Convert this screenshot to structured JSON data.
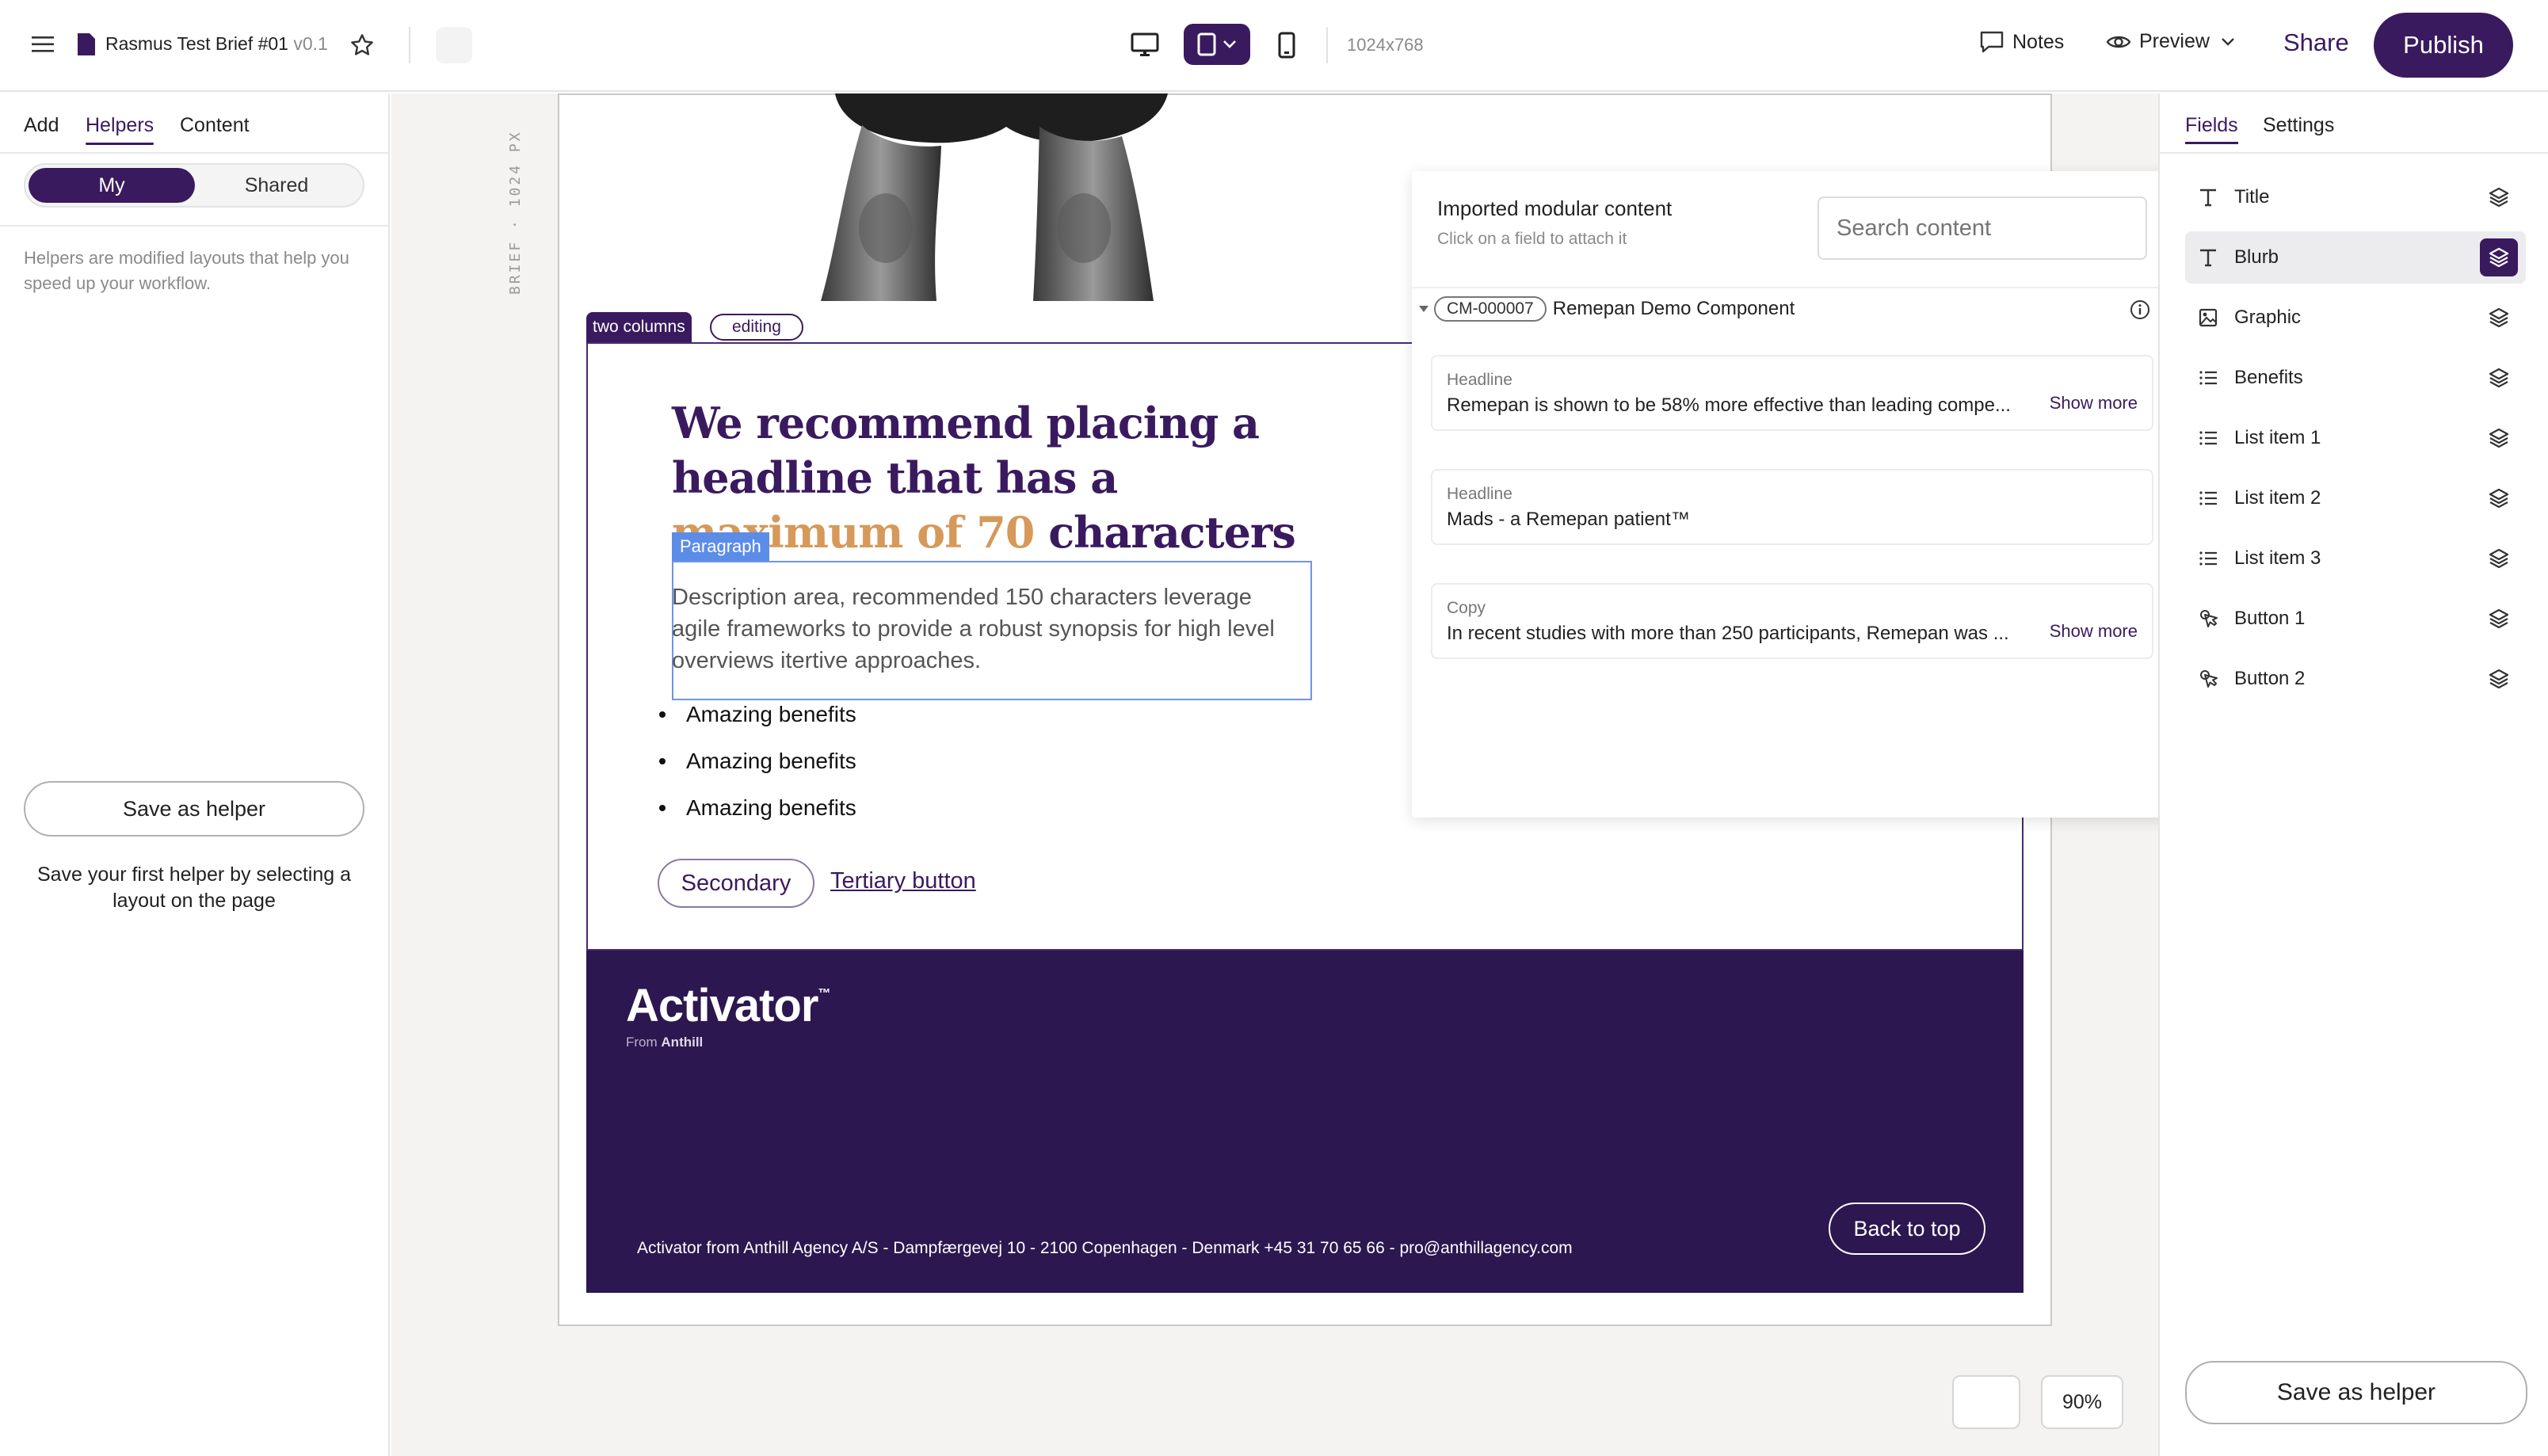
{
  "topbar": {
    "doc_title": "Rasmus Test Brief #01",
    "version": "v0.1",
    "resolution": "1024x768",
    "notes_label": "Notes",
    "preview_label": "Preview",
    "share_label": "Share",
    "publish_label": "Publish"
  },
  "left": {
    "tabs": [
      "Add",
      "Helpers",
      "Content"
    ],
    "active_tab": "Helpers",
    "segments": [
      "My",
      "Shared"
    ],
    "helper_desc": "Helpers are modified layouts that help you speed up your workflow.",
    "save_helper_label": "Save as helper",
    "save_hint": "Save your first helper by selecting a layout on the page"
  },
  "canvas": {
    "ruler_label": "BRIEF · 1024 PX",
    "layout_tag": "two columns",
    "layout_state": "editing",
    "headline_part1": "We recommend placing a headline that has a",
    "headline_highlight": "maximum of 70",
    "headline_part2": "characters",
    "paragraph_tag": "Paragraph",
    "paragraph": "Description area, recommended 150 characters leverage agile frameworks to provide a robust synopsis for high level overviews itertive approaches.",
    "benefits": [
      "Amazing benefits",
      "Amazing benefits",
      "Amazing benefits"
    ],
    "secondary_label": "Secondary",
    "tertiary_label": "Tertiary button",
    "brand": "Activator",
    "brand_tm": "™",
    "brand_from": "From",
    "brand_company": "Anthill",
    "footer_text": "Activator from Anthill Agency A/S - Dampfærgevej 10 - 2100 Copenhagen - Denmark +45 31 70 65 66 - pro@anthillagency.com",
    "back_to_top": "Back to top",
    "zoom": "90%"
  },
  "imported": {
    "title": "Imported modular content",
    "subtitle": "Click on a field to attach it",
    "search_placeholder": "Search content",
    "component_id": "CM-000007",
    "component_name": "Remepan Demo Component",
    "cards": [
      {
        "label": "Headline",
        "value": "Remepan is shown to be 58% more effective than leading compe...",
        "more": "Show more"
      },
      {
        "label": "Headline",
        "value": "Mads - a Remepan patient™",
        "more": ""
      },
      {
        "label": "Copy",
        "value": "In recent studies with more than 250 participants, Remepan was ...",
        "more": "Show more"
      }
    ]
  },
  "right": {
    "tabs": [
      "Fields",
      "Settings"
    ],
    "active_tab": "Fields",
    "fields": [
      {
        "name": "Title",
        "icon": "text-icon"
      },
      {
        "name": "Blurb",
        "icon": "text-icon",
        "selected": true
      },
      {
        "name": "Graphic",
        "icon": "image-icon"
      },
      {
        "name": "Benefits",
        "icon": "list-icon"
      },
      {
        "name": "List item 1",
        "icon": "list-icon"
      },
      {
        "name": "List item 2",
        "icon": "list-icon"
      },
      {
        "name": "List item 3",
        "icon": "list-icon"
      },
      {
        "name": "Button 1",
        "icon": "pointer-icon"
      },
      {
        "name": "Button 2",
        "icon": "pointer-icon"
      }
    ],
    "save_helper_label": "Save as helper"
  },
  "colors": {
    "brand_purple": "#3a1a5f",
    "footer_purple": "#2c1750",
    "highlight_orange": "#d6995a",
    "paragraph_blue": "#5b8de8"
  }
}
